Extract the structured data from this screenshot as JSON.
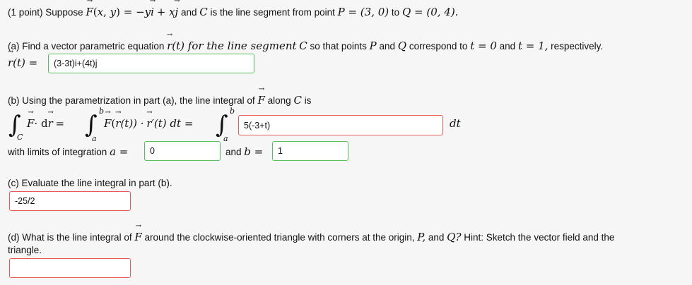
{
  "problem": {
    "points": "(1 point)",
    "suppose": "Suppose",
    "F_eq": "= −y",
    "plus_x": "+ x",
    "and_C": "and",
    "C": "C",
    "desc": "is the line segment from point",
    "P_eq": "P = (3, 0)",
    "to": "to",
    "Q_eq": "Q = (0, 4)."
  },
  "part_a": {
    "text1": "(a) Find a vector parametric equation",
    "text2": "(t) for the line segment",
    "text3": "so that points",
    "P": "P",
    "and": "and",
    "Q": "Q",
    "text4": "correspond to",
    "t0": "t = 0",
    "and2": "and",
    "t1": "t = 1,",
    "respectively": "respectively.",
    "lhs": "(t) =",
    "answer": "(3-3t)i+(4t)j"
  },
  "part_b": {
    "text1": "(b) Using the parametrization in part (a), the line integral of",
    "along": "along",
    "C": "C",
    "is": "is",
    "sub_C": "C",
    "lim_a": "a",
    "lim_b": "b",
    "dot_dr": "·  d",
    "eq1": "=",
    "F_of": "(",
    "r_of_t": "(t)) ·",
    "rprime": "′(t) dt =",
    "integrand_answer": "5(-3+t)",
    "dt": "dt",
    "limits_text": "with limits of integration",
    "a_eq": "a =",
    "a_value": "0",
    "and": "and",
    "b_eq": "b =",
    "b_value": "1"
  },
  "part_c": {
    "text": "(c) Evaluate the line integral in part (b).",
    "answer": "-25/2"
  },
  "part_d": {
    "text1": "(d) What is the line integral of",
    "text2": "around the clockwise-oriented triangle with corners at the origin,",
    "P": "P,",
    "and": "and",
    "Q": "Q?",
    "hint": "Hint: Sketch the vector field and the",
    "line2": "triangle.",
    "answer": ""
  },
  "symbols": {
    "F": "F",
    "r": "r",
    "i": "i",
    "j": "j",
    "x": "x",
    "y": "y"
  },
  "colors": {
    "correct_border": "#55c15a",
    "incorrect_border": "#e65a5a",
    "background": "#f6f6f6"
  }
}
